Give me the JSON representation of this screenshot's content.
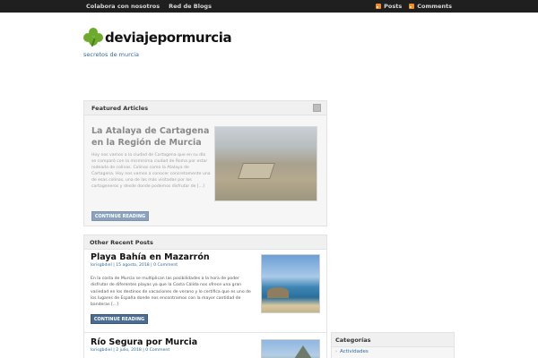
{
  "topnav": {
    "items": [
      "Colabora con nosotros",
      "Red de Blogs"
    ]
  },
  "feeds": {
    "posts": "Posts",
    "comments": "Comments",
    "icon": "rss-icon"
  },
  "header": {
    "title": "deviajepormurcia",
    "tagline": "secretos de murcia",
    "logo_icon": "clover-icon"
  },
  "featured": {
    "heading": "Featured Articles",
    "title": "La Atalaya de Cartagena en la Región de Murcia",
    "excerpt": "Hoy nos vamos a la ciudad de Cartagena que en su día se comparó con la mismísima ciudad de Roma por estar rodeada de colinas. Colinas como la Atalaya de Cartagena. Hoy nos vamos a conocer concretamente una de esas colinas, una de las más visitadas por los cartageneros y desde donde podemos disfrutar de [...]",
    "button": "CONTINUE READING"
  },
  "recent": {
    "heading": "Other Recent Posts",
    "posts": [
      {
        "title": "Playa Bahía en Mazarrón",
        "meta": "lorisgbdiel | 15 agosto, 2018 | 0 Comment",
        "excerpt": "En la costa de Murcia se multiplican las posibilidades a la hora de poder disfrutar de diferentes playas ya que la Costa Cálida nos ofrece una gran variedad en los destinos de vacaciones de verano y lo certifica que es uno de los lugares de España donde nos encontramos con la mayor cantidad de banderas [...]",
        "button": "CONTINUE READING"
      },
      {
        "title": "Río Segura por Murcia",
        "meta": "lorisgbdiel | 2 julio, 2018 | 0 Comment"
      }
    ]
  },
  "sidebar": {
    "categories": {
      "heading": "Categorías",
      "items": [
        "Actividades"
      ]
    }
  },
  "colors": {
    "topbar": "#1f1f1f",
    "accent": "#2f6aa0",
    "button": "#4b6d93",
    "logo_green": "#6cab2c"
  }
}
